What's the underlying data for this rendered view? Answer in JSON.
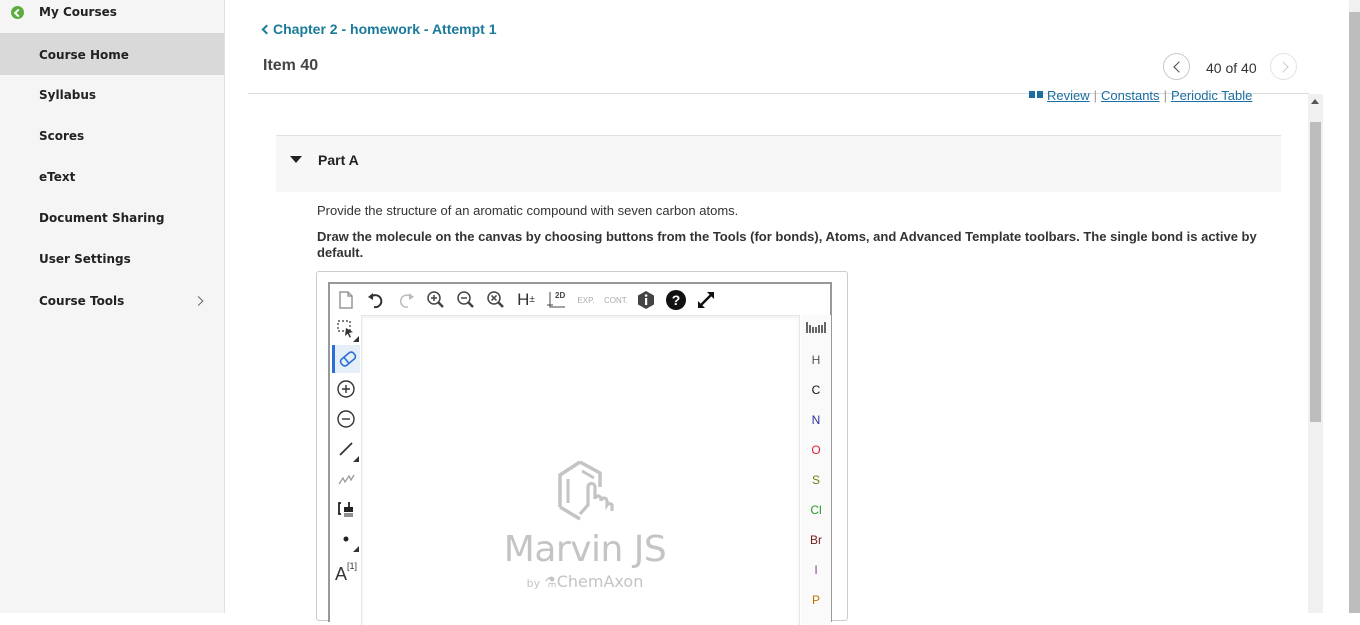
{
  "sidebar": {
    "back_label": "My Courses",
    "items": [
      {
        "label": "Course Home",
        "active": true
      },
      {
        "label": "Syllabus"
      },
      {
        "label": "Scores"
      },
      {
        "label": "eText"
      },
      {
        "label": "Document Sharing"
      },
      {
        "label": "User Settings"
      },
      {
        "label": "Course Tools",
        "has_submenu": true
      }
    ]
  },
  "header": {
    "breadcrumb": "Chapter 2 - homework - Attempt 1",
    "item_title": "Item 40",
    "pager": {
      "text": "40 of 40",
      "current": 40,
      "total": 40
    }
  },
  "resources": {
    "review": "Review",
    "constants": "Constants",
    "periodic_table": "Periodic Table",
    "separator": "|"
  },
  "part": {
    "title": "Part A",
    "question": "Provide the structure of an aromatic compound with seven carbon atoms.",
    "instructions": "Draw the molecule on the canvas by choosing buttons from the Tools (for bonds), Atoms, and Advanced Template toolbars. The single bond is active by default."
  },
  "editor": {
    "top_toolbar": [
      "new-document-icon",
      "undo-icon",
      "redo-icon",
      "zoom-in-icon",
      "zoom-out-icon",
      "zoom-fit-icon",
      "hydrogen-toggle-icon",
      "clean-2d-icon",
      "expand-group-icon",
      "contract-group-icon",
      "info-icon",
      "help-icon",
      "fullscreen-icon"
    ],
    "top_labels": {
      "h": "H",
      "clean2d": "2D",
      "exp": "EXP.",
      "cont": "CONT."
    },
    "left_toolbar": [
      "selection-tool",
      "erase-tool",
      "increase-charge",
      "decrease-charge",
      "single-bond",
      "chain-tool",
      "bracket-tool",
      "radical-tool",
      "atom-map-tool"
    ],
    "active_tool": "erase-tool",
    "atom_map_label": "A",
    "atom_map_sup": "[1]",
    "atoms": [
      {
        "symbol": "H",
        "color": "#555555"
      },
      {
        "symbol": "C",
        "color": "#111111"
      },
      {
        "symbol": "N",
        "color": "#3030a0"
      },
      {
        "symbol": "O",
        "color": "#e0203a"
      },
      {
        "symbol": "S",
        "color": "#7a7a10"
      },
      {
        "symbol": "Cl",
        "color": "#2a9a20"
      },
      {
        "symbol": "Br",
        "color": "#702020"
      },
      {
        "symbol": "I",
        "color": "#8a40a8"
      },
      {
        "symbol": "P",
        "color": "#c07000"
      }
    ],
    "logo": {
      "title": "Marvin JS",
      "by": "by",
      "vendor": "ChemAxon"
    }
  },
  "colors": {
    "link": "#1a6ea0",
    "breadcrumb": "#1a7a9a",
    "active_tool": "#2b6fd6",
    "back_icon": "#5aad3e"
  }
}
